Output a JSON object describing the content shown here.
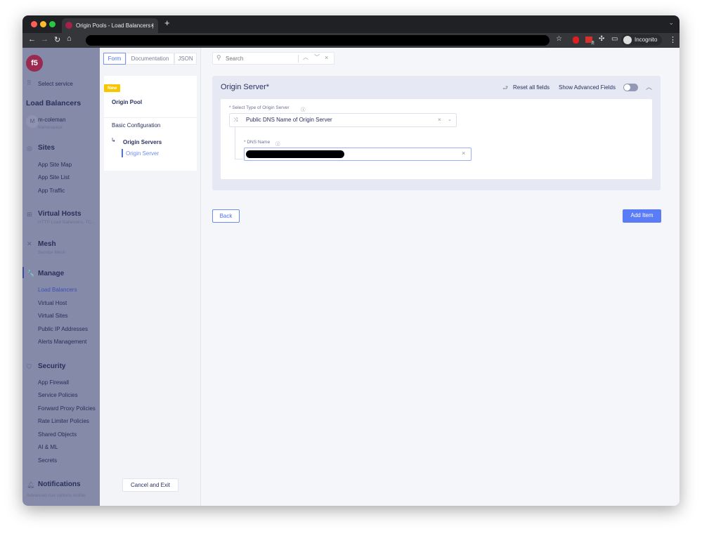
{
  "browser": {
    "tab_title": "Origin Pools - Load Balancers |",
    "incognito_label": "Incognito",
    "extension_badge": "8"
  },
  "sidebar": {
    "select_service": "Select service",
    "title": "Load Balancers",
    "namespace": {
      "initial": "M",
      "name": "m-coleman",
      "label": "Namespace"
    },
    "sections": [
      {
        "title": "Sites",
        "items": [
          "App Site Map",
          "App Site List",
          "App Traffic"
        ]
      },
      {
        "title": "Virtual Hosts",
        "subtitle": "HTTP Load Balancers, TC..."
      },
      {
        "title": "Mesh",
        "subtitle": "Service Mesh"
      },
      {
        "title": "Manage",
        "items": [
          "Load Balancers",
          "Virtual Host",
          "Virtual Sites",
          "Public IP Addresses",
          "Alerts Management"
        ]
      },
      {
        "title": "Security",
        "items": [
          "App Firewall",
          "Service Policies",
          "Forward Proxy Policies",
          "Rate Limiter Policies",
          "Shared Objects",
          "AI & ML",
          "Secrets"
        ]
      },
      {
        "title": "Notifications"
      }
    ],
    "footer": "Advanced nav options visible"
  },
  "left_panel": {
    "tabs": [
      "Form",
      "Documentation",
      "JSON"
    ],
    "badge": "New",
    "pool_title": "Origin Pool",
    "nav": [
      "Basic Configuration",
      "Origin Servers",
      "Origin Server"
    ],
    "cancel": "Cancel and Exit"
  },
  "main": {
    "search_placeholder": "Search",
    "section_title": "Origin Server*",
    "reset": "Reset all fields",
    "advanced": "Show Advanced Fields",
    "advanced_on": false,
    "type_label": "* Select Type of Origin Server",
    "type_value": "Public DNS Name of Origin Server",
    "dns_label": "* DNS Name",
    "dns_value": "",
    "back": "Back",
    "add": "Add Item"
  },
  "colors": {
    "accent": "#4c6ef5",
    "brand": "#a3234a",
    "badge": "#f7c600"
  }
}
